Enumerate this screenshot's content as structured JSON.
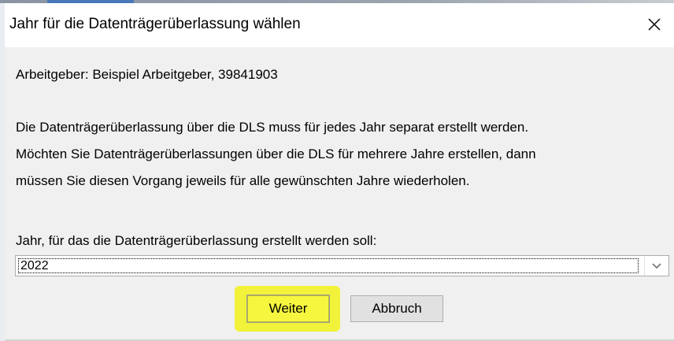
{
  "dialog": {
    "title": "Jahr für die Datenträgerüberlassung wählen",
    "employer_line": "Arbeitgeber: Beispiel Arbeitgeber, 39841903",
    "info_lines": [
      "Die Datenträgerüberlassung über die DLS muss für jedes Jahr separat erstellt werden.",
      "Möchten Sie Datenträgerüberlassungen über die DLS für mehrere Jahre erstellen, dann",
      "müssen Sie diesen Vorgang jeweils für alle gewünschten Jahre wiederholen."
    ],
    "year_label": "Jahr, für das die Datenträgerüberlassung erstellt werden soll:",
    "year_value": "2022",
    "buttons": {
      "next": "Weiter",
      "cancel": "Abbruch"
    }
  },
  "icons": {
    "close": "close-icon",
    "dropdown": "chevron-down-icon"
  },
  "colors": {
    "highlight": "#f2f23a",
    "client_background": "#f0f0f0",
    "button_background": "#e1e1e1"
  }
}
